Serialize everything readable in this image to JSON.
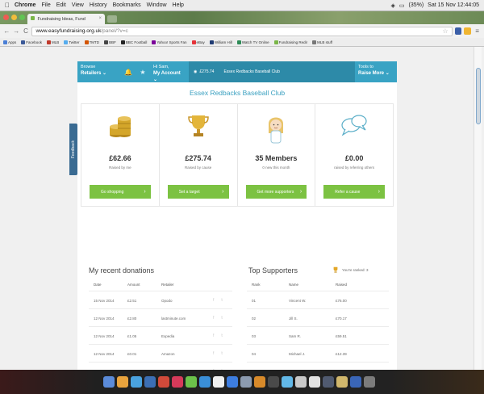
{
  "menubar": {
    "app": "Chrome",
    "items": [
      "File",
      "Edit",
      "View",
      "History",
      "Bookmarks",
      "Window",
      "Help"
    ],
    "battery": "(35%)",
    "clock": "Sat 15 Nov 12:44:05"
  },
  "tab": {
    "title": "Fundraising Ideas, Fund",
    "close": "×"
  },
  "toolbar": {
    "back": "←",
    "forward": "→",
    "reload": "C",
    "url_host": "www.easyfundraising.org.uk",
    "url_path": "/panel/?v=c",
    "star": "☆"
  },
  "bookmarks": [
    {
      "label": "Apps",
      "color": "#4a7fd6"
    },
    {
      "label": "Facebook",
      "color": "#3b5998"
    },
    {
      "label": "MLB",
      "color": "#c0392b"
    },
    {
      "label": "Twitter",
      "color": "#55acee"
    },
    {
      "label": "TMTD",
      "color": "#d35400"
    },
    {
      "label": "BBF",
      "color": "#444"
    },
    {
      "label": "BBC Football",
      "color": "#222"
    },
    {
      "label": "Yahoo! Sports Fan",
      "color": "#7b0099"
    },
    {
      "label": "eBay",
      "color": "#e53238"
    },
    {
      "label": "William Hill",
      "color": "#1f3b73"
    },
    {
      "label": "Watch TV Online",
      "color": "#2e8b57"
    },
    {
      "label": "Fundraising Redir",
      "color": "#7ab648"
    },
    {
      "label": "MLB stuff",
      "color": "#777"
    }
  ],
  "sitenav": {
    "browse_top": "Browse",
    "browse_bottom": "Retailers",
    "chev": "⌄",
    "bell": "🔔",
    "star": "★",
    "account_top": "Hi Sam,",
    "account_bottom": "My Account",
    "balance": "£275.74",
    "club": "Essex Redbacks Baseball Club",
    "tools_top": "Tools to",
    "tools_bottom": "Raise More"
  },
  "club_title": "Essex Redbacks Baseball Club",
  "cards": [
    {
      "value": "£62.66",
      "sub": "Raised by me",
      "button": "Go shopping",
      "chev": "›"
    },
    {
      "value": "£275.74",
      "sub": "Raised by cause",
      "button": "Set a target",
      "chev": "›"
    },
    {
      "value": "35 Members",
      "sub": "0 new this month",
      "button": "Get more supporters",
      "chev": "›"
    },
    {
      "value": "£0.00",
      "sub": "raised by referring others",
      "button": "Refer a cause",
      "chev": "›"
    }
  ],
  "donations": {
    "title": "My recent donations",
    "headers": [
      "Date",
      "Amount",
      "Retailer"
    ],
    "rows": [
      [
        "15 Nov 2014",
        "£2.51",
        "Opodo"
      ],
      [
        "12 Nov 2014",
        "£2.80",
        "lastminute.com"
      ],
      [
        "12 Nov 2014",
        "£1.05",
        "Expedia"
      ],
      [
        "12 Nov 2014",
        "£0.01",
        "Amazon"
      ],
      [
        "12 Nov 2014",
        "£0.49",
        "Amazon"
      ]
    ],
    "social_f": "f",
    "social_t": "𝕥"
  },
  "supporters": {
    "title": "Top Supporters",
    "ranked": "You're ranked: 3",
    "headers": [
      "Rank",
      "Name",
      "Raised"
    ],
    "rows": [
      [
        "01",
        "Vincent W.",
        "£76.00"
      ],
      [
        "02",
        "Jill S.",
        "£70.17"
      ],
      [
        "03",
        "Sam R.",
        "£59.51"
      ],
      [
        "04",
        "Michael J.",
        "£12.39"
      ],
      [
        "05",
        "Richard C.",
        "£11.67"
      ]
    ]
  },
  "feedback": "Feedback",
  "colors": {
    "nav": "#39a3c4",
    "nav_dark": "#2d8aa8",
    "accent_text": "#3aa0c0",
    "button_green": "#7cc242"
  },
  "dock_colors": [
    "#5b8bd9",
    "#e8a33d",
    "#4aa3df",
    "#3c6fb4",
    "#d14a3a",
    "#d63a5a",
    "#6cc24a",
    "#3a8fd8",
    "#f0f0f0",
    "#3d7de0",
    "#8c9bb0",
    "#d88a2a",
    "#4a4a4a",
    "#62b8e8",
    "#c9c9c9",
    "#e2e2e2",
    "#505a70",
    "#d1b76c",
    "#3a66b8",
    "#7b7b7b"
  ]
}
